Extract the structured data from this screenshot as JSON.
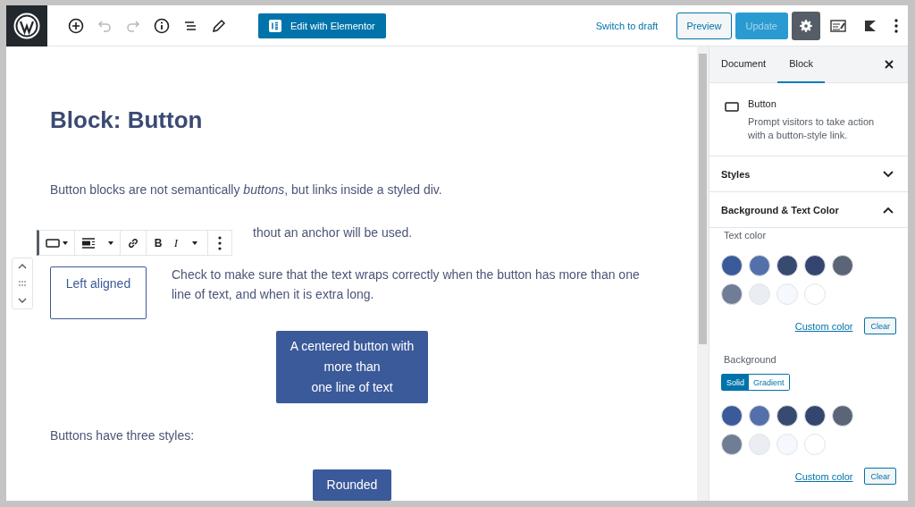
{
  "top_toolbar": {
    "tools": [
      {
        "kind": "add",
        "disabled": false
      },
      {
        "kind": "undo",
        "disabled": true
      },
      {
        "kind": "redo",
        "disabled": true
      },
      {
        "kind": "info",
        "disabled": false
      },
      {
        "kind": "outline",
        "disabled": false
      },
      {
        "kind": "edit",
        "disabled": false
      }
    ],
    "elementor_button": "Edit with Elementor",
    "switch_to_draft": "Switch to draft",
    "preview": "Preview",
    "update": {
      "label": "Update",
      "disabled": true
    },
    "right_icons": [
      {
        "kind": "settings",
        "pressed": true
      },
      {
        "kind": "editor",
        "pressed": false
      },
      {
        "kind": "plugin",
        "pressed": false
      },
      {
        "kind": "more",
        "pressed": false
      }
    ]
  },
  "content": {
    "title": "Block: Button",
    "blocks": [
      {
        "kind": "paragraph",
        "text": "Button blocks are not semantically *buttons*, but links inside a styled div."
      },
      {
        "kind": "covered-paragraph",
        "text": "thout an anchor will be used."
      },
      {
        "kind": "button-with-text",
        "button": "Left aligned",
        "selected": true,
        "text": "Check to make sure that the text wraps correctly when the button has more than one line of text, and when it is extra long."
      },
      {
        "kind": "button",
        "lines": [
          "A centered button with",
          "more than",
          "one line of text"
        ]
      },
      {
        "kind": "paragraph",
        "text": "Buttons have three styles:"
      },
      {
        "kind": "button",
        "lines": [
          "Rounded"
        ]
      }
    ]
  },
  "block_toolbar": [
    {
      "kind": "block-type"
    },
    {
      "kind": "align"
    },
    {
      "kind": "link"
    },
    {
      "kind": "bold",
      "label": "B"
    },
    {
      "kind": "italic",
      "label": "I"
    },
    {
      "kind": "more-format"
    },
    {
      "kind": "options"
    }
  ],
  "sidebar": {
    "tabs": [
      {
        "label": "Document",
        "selected": false
      },
      {
        "label": "Block",
        "selected": true
      }
    ],
    "block_card": {
      "name": "Button",
      "description": "Prompt visitors to take action with a button-style link."
    },
    "panels": [
      {
        "title": "Styles",
        "expanded": false
      },
      {
        "title": "Background & Text Color",
        "expanded": true
      }
    ],
    "text_color": {
      "label": "Text color",
      "swatches": [
        {
          "color": "#3b5a9a"
        },
        {
          "color": "#5470aa"
        },
        {
          "color": "#374a70"
        },
        {
          "color": "#344670"
        },
        {
          "color": "#5c6577"
        },
        {
          "color": "#6f7d95"
        },
        {
          "color": "#eaedf2"
        },
        {
          "color": "#f5f8fc"
        },
        {
          "color": "#ffffff"
        }
      ],
      "custom": "Custom color",
      "clear": "Clear"
    },
    "background": {
      "label": "Background",
      "modes": [
        {
          "label": "Solid",
          "selected": true
        },
        {
          "label": "Gradient",
          "selected": false
        }
      ],
      "swatches": [
        {
          "color": "#3b5a9a"
        },
        {
          "color": "#5470aa"
        },
        {
          "color": "#374a70"
        },
        {
          "color": "#344670"
        },
        {
          "color": "#5c6577"
        },
        {
          "color": "#6f7d95"
        },
        {
          "color": "#eaedf2"
        },
        {
          "color": "#f5f8fc"
        },
        {
          "color": "#ffffff"
        }
      ],
      "custom": "Custom color",
      "clear": "Clear"
    }
  }
}
